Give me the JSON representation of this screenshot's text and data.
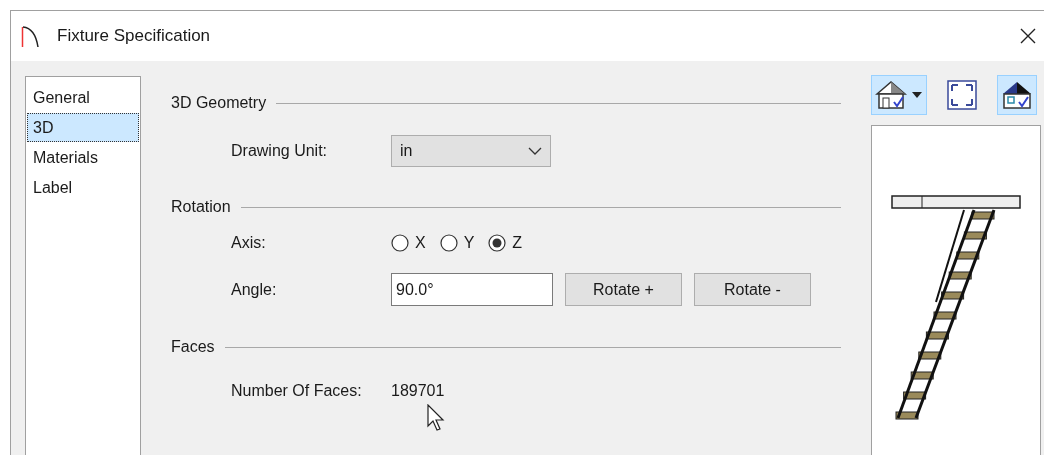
{
  "window": {
    "title": "Fixture Specification"
  },
  "sidebar": {
    "items": [
      {
        "label": "General",
        "selected": false
      },
      {
        "label": "3D",
        "selected": true
      },
      {
        "label": "Materials",
        "selected": false
      },
      {
        "label": "Label",
        "selected": false
      }
    ]
  },
  "geometry": {
    "title": "3D Geometry",
    "drawing_unit": {
      "label": "Drawing Unit:",
      "value": "in"
    }
  },
  "rotation": {
    "title": "Rotation",
    "axis": {
      "label": "Axis:",
      "options": [
        {
          "label": "X",
          "selected": false
        },
        {
          "label": "Y",
          "selected": false
        },
        {
          "label": "Z",
          "selected": true
        }
      ]
    },
    "angle": {
      "label": "Angle:",
      "value": "90.0°"
    },
    "buttons": [
      "Rotate +",
      "Rotate -"
    ]
  },
  "faces": {
    "title": "Faces",
    "count_label": "Number Of Faces:",
    "count": "189701"
  },
  "preview_toolbar": [
    {
      "kind": "house",
      "selected": true,
      "has_menu": true
    },
    {
      "kind": "fit",
      "selected": false,
      "has_menu": false
    },
    {
      "kind": "shaded",
      "selected": true,
      "has_menu": false
    }
  ]
}
